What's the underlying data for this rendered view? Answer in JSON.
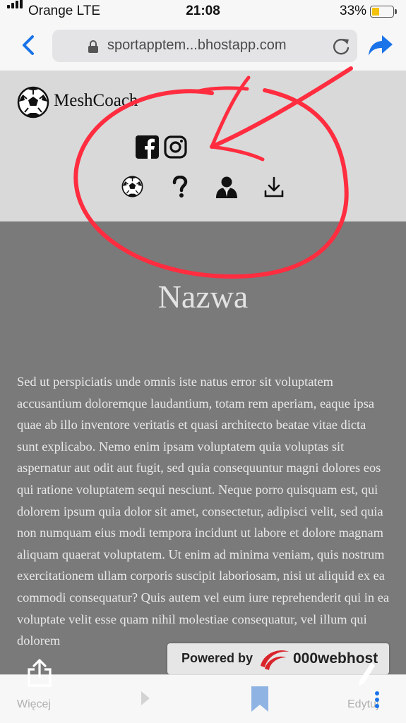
{
  "status_bar": {
    "carrier": "Orange  LTE",
    "time": "21:08",
    "battery": "33%"
  },
  "browser": {
    "url": "sportapptem...bhostapp.com"
  },
  "site": {
    "brand": "MeshCoach",
    "title": "Nazwa",
    "body": "Sed ut perspiciatis unde omnis iste natus error sit voluptatem accusantium doloremque laudantium, totam rem aperiam, eaque ipsa quae ab illo inventore veritatis et quasi architecto beatae vitae dicta sunt explicabo. Nemo enim ipsam voluptatem quia voluptas sit aspernatur aut odit aut fugit, sed quia consequuntur magni dolores eos qui ratione voluptatem sequi nesciunt. Neque porro quisquam est, qui dolorem ipsum quia dolor sit amet, consectetur, adipisci velit, sed quia non numquam eius modi tempora incidunt ut labore et dolore magnam aliquam quaerat voluptatem. Ut enim ad minima veniam, quis nostrum exercitationem ullam corporis suscipit laboriosam, nisi ut aliquid ex ea commodi consequatur? Quis autem vel eum iure reprehenderit qui in ea voluptate velit esse quam nihil molestiae consequatur, vel illum qui dolorem"
  },
  "hosting_badge": {
    "powered_by": "Powered by",
    "host": "000webhost"
  },
  "toolbar": {
    "more_label": "Więcej",
    "edit_label": "Edytuj"
  },
  "colors": {
    "link_blue": "#1a73e8",
    "annotation_red": "#ff2d3f",
    "battery_yellow": "#f4c20d"
  },
  "icons": [
    "signal-icon",
    "lock-icon",
    "reload-icon",
    "share-arrow-icon",
    "soccer-ball-icon",
    "facebook-icon",
    "instagram-icon",
    "help-icon",
    "user-icon",
    "download-icon",
    "upload-icon",
    "forward-icon",
    "bookmark-icon",
    "edit-icon"
  ]
}
